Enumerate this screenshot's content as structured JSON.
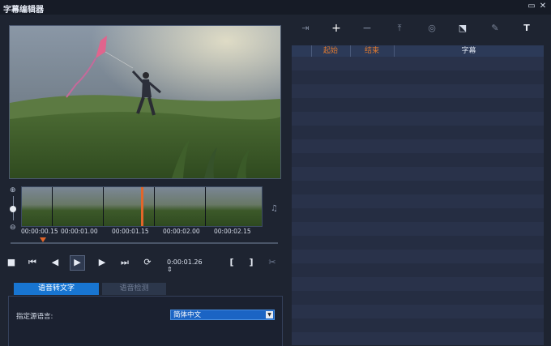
{
  "window": {
    "title": "字幕编辑器",
    "maximize_icon": "maximize-icon",
    "close_icon": "close-icon"
  },
  "preview": {
    "description_icon": "video-preview"
  },
  "timeline": {
    "timecodes": [
      "00:00:00.15",
      "00:00:01.00",
      "00:00:01.15",
      "00:00:02.00",
      "00:00:02.15"
    ]
  },
  "playback": {
    "current_time": "0:00:01.26",
    "buttons": [
      "stop",
      "go-to-start",
      "previous-frame",
      "play",
      "next-frame",
      "go-to-end",
      "repeat"
    ],
    "mark_in": "[",
    "mark_out": "]"
  },
  "tabs": [
    {
      "label": "语音转文字",
      "active": true
    },
    {
      "label": "语音检测",
      "active": false
    }
  ],
  "speech": {
    "language_label": "指定源语言:",
    "language_value": "简体中文"
  },
  "subtitle_toolbar": [
    "import-icon",
    "add-icon",
    "remove-icon",
    "export-icon",
    "scan-icon",
    "merge-icon",
    "edit-icon",
    "text-style-icon"
  ],
  "subtitle_list": {
    "columns": [
      "",
      "起始",
      "结束",
      "字幕"
    ],
    "row_count": 21
  },
  "colors": {
    "accent": "#1875d1",
    "playhead": "#e2662a",
    "header_highlight": "#e07a30"
  }
}
